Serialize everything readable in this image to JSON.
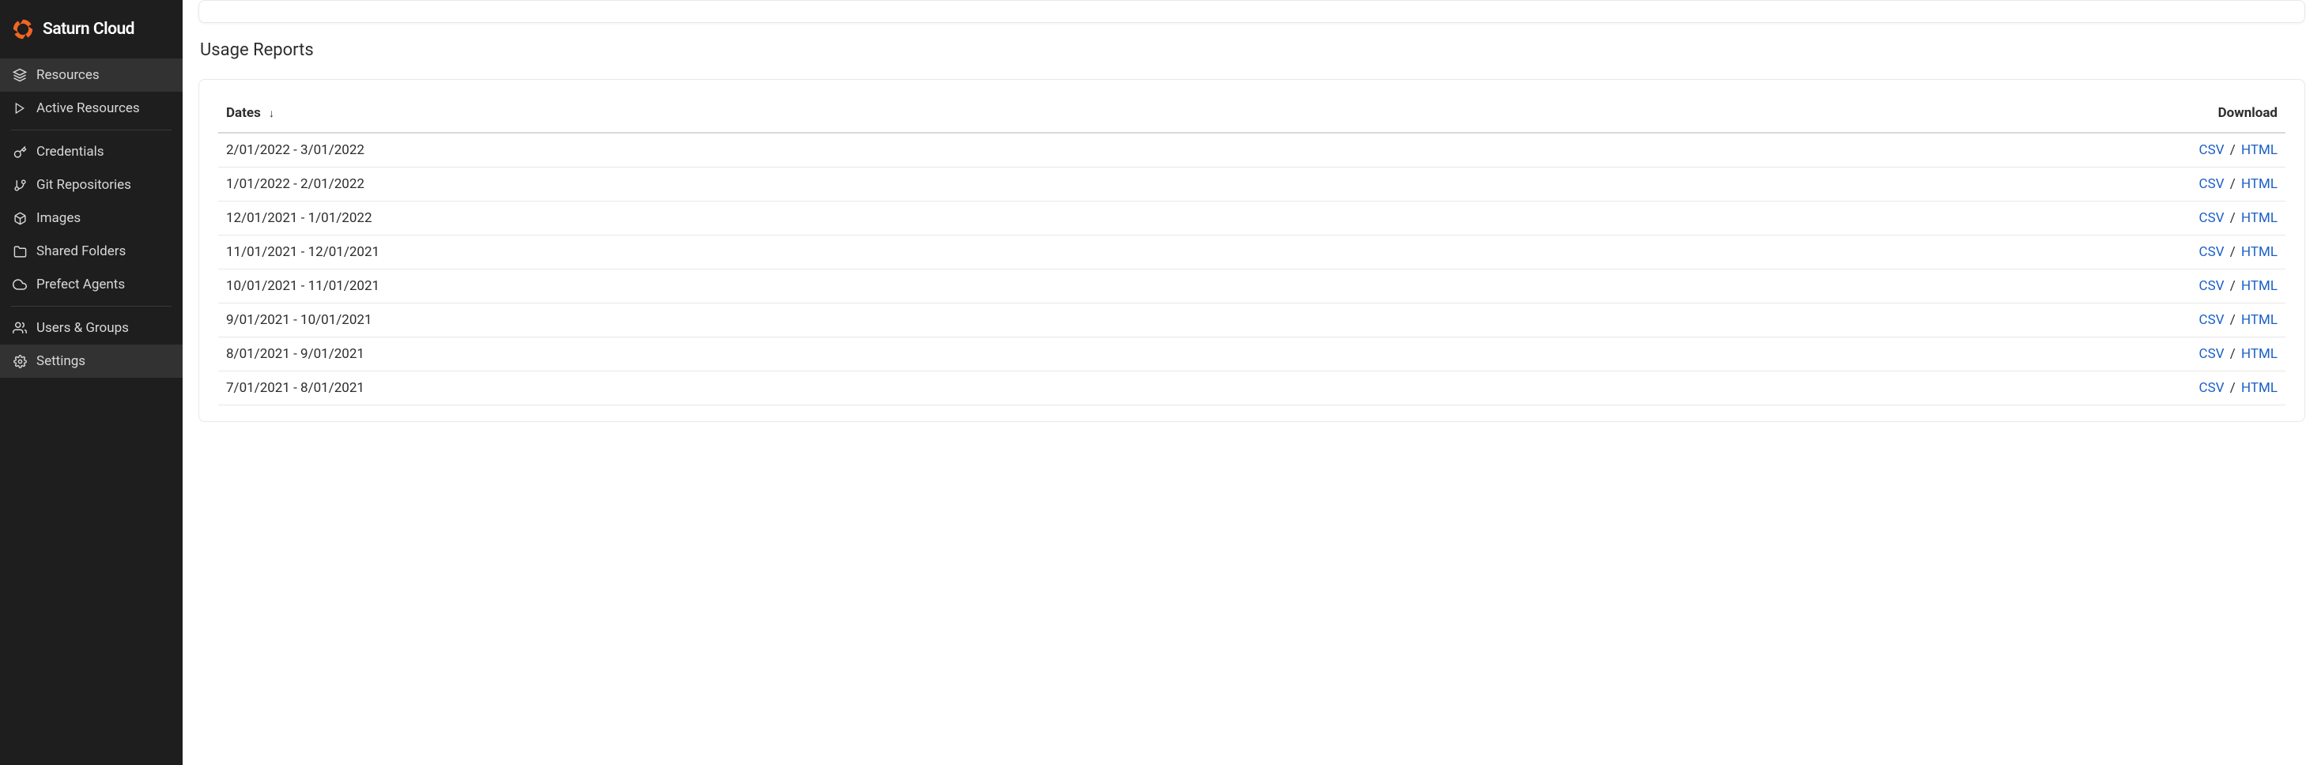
{
  "brand": {
    "name": "Saturn Cloud"
  },
  "sidebar": {
    "items": [
      {
        "label": "Resources",
        "icon": "layers-icon",
        "active": true
      },
      {
        "label": "Active Resources",
        "icon": "play-icon",
        "active": false
      }
    ],
    "items2": [
      {
        "label": "Credentials",
        "icon": "key-icon"
      },
      {
        "label": "Git Repositories",
        "icon": "git-branch-icon"
      },
      {
        "label": "Images",
        "icon": "cube-icon"
      },
      {
        "label": "Shared Folders",
        "icon": "folder-icon"
      },
      {
        "label": "Prefect Agents",
        "icon": "cloud-icon"
      }
    ],
    "items3": [
      {
        "label": "Users & Groups",
        "icon": "users-icon"
      },
      {
        "label": "Settings",
        "icon": "gear-icon",
        "active": true
      }
    ]
  },
  "main": {
    "section_title": "Usage Reports",
    "table": {
      "header_dates": "Dates",
      "header_download": "Download",
      "csv_label": "CSV",
      "html_label": "HTML",
      "separator": "/",
      "rows": [
        {
          "dates": "2/01/2022 - 3/01/2022"
        },
        {
          "dates": "1/01/2022 - 2/01/2022"
        },
        {
          "dates": "12/01/2021 - 1/01/2022"
        },
        {
          "dates": "11/01/2021 - 12/01/2021"
        },
        {
          "dates": "10/01/2021 - 11/01/2021"
        },
        {
          "dates": "9/01/2021 - 10/01/2021"
        },
        {
          "dates": "8/01/2021 - 9/01/2021"
        },
        {
          "dates": "7/01/2021 - 8/01/2021"
        }
      ]
    }
  }
}
